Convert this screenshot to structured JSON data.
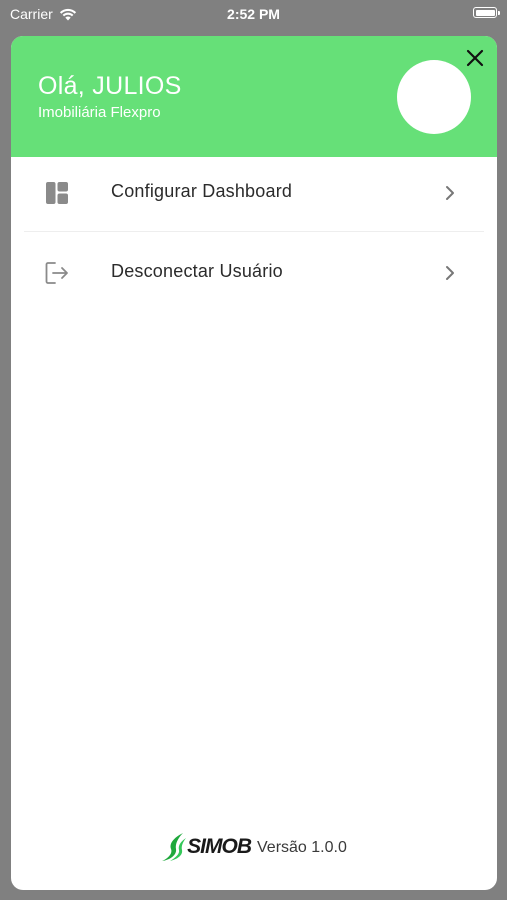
{
  "status_bar": {
    "carrier": "Carrier",
    "time": "2:52 PM"
  },
  "header": {
    "greeting": "Olá, JULIOS",
    "company": "Imobiliária Flexpro",
    "background_color": "#66e078"
  },
  "menu": {
    "items": [
      {
        "label": "Configurar Dashboard",
        "icon": "dashboard-icon"
      },
      {
        "label": "Desconectar Usuário",
        "icon": "logout-icon"
      }
    ]
  },
  "footer": {
    "logo_text": "SIMOB",
    "version": "Versão 1.0.0"
  },
  "colors": {
    "accent": "#66e078",
    "logo_green": "#1fa83c"
  }
}
